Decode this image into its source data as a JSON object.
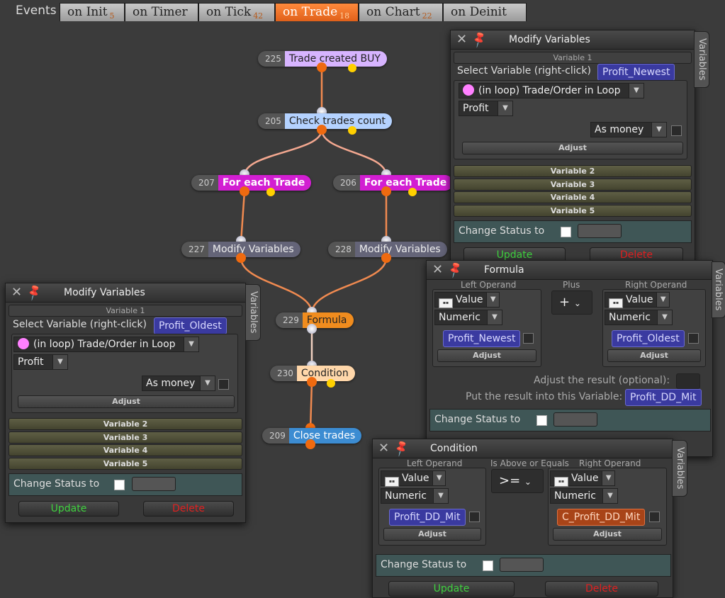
{
  "tabs": {
    "events_label": "Events",
    "items": [
      {
        "label": "on Init",
        "count": "5"
      },
      {
        "label": "on Timer",
        "count": ""
      },
      {
        "label": "on Tick",
        "count": "42"
      },
      {
        "label": "on Trade",
        "count": "18"
      },
      {
        "label": "on Chart",
        "count": "22"
      },
      {
        "label": "on Deinit",
        "count": ""
      }
    ],
    "active": "on Trade"
  },
  "nodes": {
    "n225": {
      "num": "225",
      "label": "Trade created BUY",
      "color": "#d7b4ff"
    },
    "n205": {
      "num": "205",
      "label": "Check trades count",
      "color": "#b4d2ff"
    },
    "n207": {
      "num": "207",
      "label": "For each Trade",
      "color": "#d21ed2"
    },
    "n206": {
      "num": "206",
      "label": "For each Trade",
      "color": "#d21ed2"
    },
    "n227": {
      "num": "227",
      "label": "Modify Variables",
      "color": "#646478"
    },
    "n228": {
      "num": "228",
      "label": "Modify Variables",
      "color": "#646478"
    },
    "n229": {
      "num": "229",
      "label": "Formula",
      "color": "#f08c1e"
    },
    "n230": {
      "num": "230",
      "label": "Condition",
      "color": "#ffd7aa"
    },
    "n209": {
      "num": "209",
      "label": "Close trades",
      "color": "#3c8cd2"
    }
  },
  "modify_right": {
    "title": "Modify Variables",
    "side_tab": "Variables",
    "var1_label": "Variable 1",
    "select_label": "Select Variable (right-click)",
    "variable": "Profit_Newest",
    "source": "(in loop) Trade/Order in Loop",
    "field": "Profit",
    "format": "As money",
    "adjust": "Adjust",
    "var2": "Variable 2",
    "var3": "Variable 3",
    "var4": "Variable 4",
    "var5": "Variable 5",
    "status_label": "Change Status to",
    "update": "Update",
    "delete": "Delete"
  },
  "modify_left": {
    "title": "Modify Variables",
    "side_tab": "Variables",
    "var1_label": "Variable 1",
    "select_label": "Select Variable (right-click)",
    "variable": "Profit_Oldest",
    "source": "(in loop) Trade/Order in Loop",
    "field": "Profit",
    "format": "As money",
    "adjust": "Adjust",
    "var2": "Variable 2",
    "var3": "Variable 3",
    "var4": "Variable 4",
    "var5": "Variable 5",
    "status_label": "Change Status to",
    "update": "Update",
    "delete": "Delete"
  },
  "formula": {
    "title": "Formula",
    "side_tab": "Variables",
    "left_operand_label": "Left Operand",
    "operator_label": "Plus",
    "right_operand_label": "Right Operand",
    "left_type": "Value",
    "left_kind": "Numeric",
    "left_var": "Profit_Newest",
    "operator": "+",
    "right_type": "Value",
    "right_kind": "Numeric",
    "right_var": "Profit_Oldest",
    "adjust": "Adjust",
    "adjust_result_label": "Adjust the result (optional):",
    "put_result_label": "Put the result into this Variable:",
    "result_var": "Profit_DD_Mit",
    "status_label": "Change Status to"
  },
  "condition": {
    "title": "Condition",
    "side_tab": "Variables",
    "left_operand_label": "Left Operand",
    "operator_label": "Is Above or Equals",
    "right_operand_label": "Right Operand",
    "left_type": "Value",
    "left_kind": "Numeric",
    "left_var": "Profit_DD_Mit",
    "operator": ">=",
    "right_type": "Value",
    "right_kind": "Numeric",
    "right_var": "C_Profit_DD_Mit",
    "adjust": "Adjust",
    "status_label": "Change Status to",
    "update": "Update",
    "delete": "Delete"
  }
}
